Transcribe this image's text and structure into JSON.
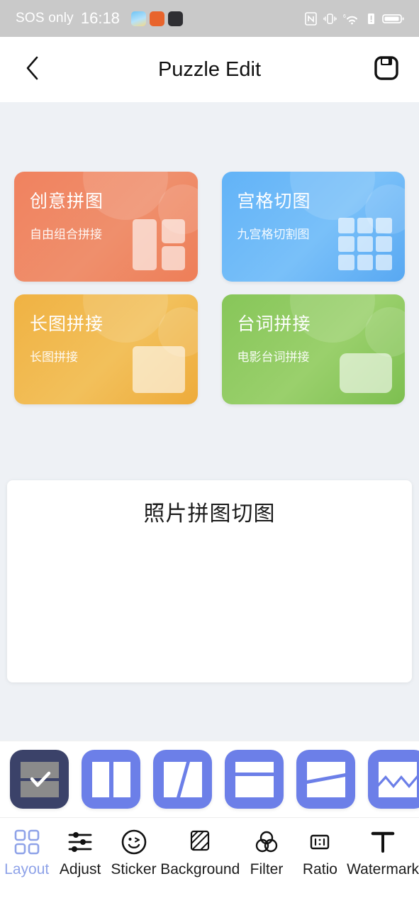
{
  "statusbar": {
    "carrier": "SOS only",
    "time": "16:18",
    "app_icons": [
      "weather-app-icon",
      "orange-app-icon",
      "dark-app-icon"
    ],
    "right_icons": [
      "nfc-icon",
      "vibrate-icon",
      "wifi-6-icon",
      "signal-alert-icon",
      "battery-icon"
    ]
  },
  "header": {
    "back_icon": "chevron-left-icon",
    "title": "Puzzle Edit",
    "save_icon": "save-icon"
  },
  "cards": [
    {
      "title": "创意拼图",
      "subtitle": "自由组合拼接",
      "color": "#ef8560",
      "art": "collage-art"
    },
    {
      "title": "宫格切图",
      "subtitle": "九宫格切割图",
      "color": "#68b6f7",
      "art": "nine-grid-art"
    },
    {
      "title": "长图拼接",
      "subtitle": "长图拼接",
      "color": "#f0b243",
      "art": "long-image-art"
    },
    {
      "title": "台词拼接",
      "subtitle": "电影台词拼接",
      "color": "#8bc85c",
      "art": "caption-art"
    }
  ],
  "preview": {
    "title": "照片拼图切图"
  },
  "layouts": {
    "selected_index": 0,
    "items": [
      {
        "name": "layout-horizontal-split",
        "selected": true
      },
      {
        "name": "layout-vertical-split",
        "selected": false
      },
      {
        "name": "layout-diagonal-split",
        "selected": false
      },
      {
        "name": "layout-horizontal-uneven",
        "selected": false
      },
      {
        "name": "layout-slanted-split",
        "selected": false
      },
      {
        "name": "layout-zigzag-split",
        "selected": false
      }
    ]
  },
  "tabs": [
    {
      "label": "Layout",
      "icon": "grid-icon",
      "active": true
    },
    {
      "label": "Adjust",
      "icon": "sliders-icon",
      "active": false
    },
    {
      "label": "Sticker",
      "icon": "smiley-icon",
      "active": false
    },
    {
      "label": "Background",
      "icon": "hatch-square-icon",
      "active": false
    },
    {
      "label": "Filter",
      "icon": "three-circles-icon",
      "active": false
    },
    {
      "label": "Ratio",
      "icon": "ratio-1-1-icon",
      "active": false
    },
    {
      "label": "Watermark",
      "icon": "text-t-icon",
      "active": false
    }
  ],
  "colors": {
    "page_background": "#eef1f5",
    "tile_blue": "#6c7fe8",
    "tile_selected": "#3b4269",
    "active_tab": "#8ea2e8"
  }
}
